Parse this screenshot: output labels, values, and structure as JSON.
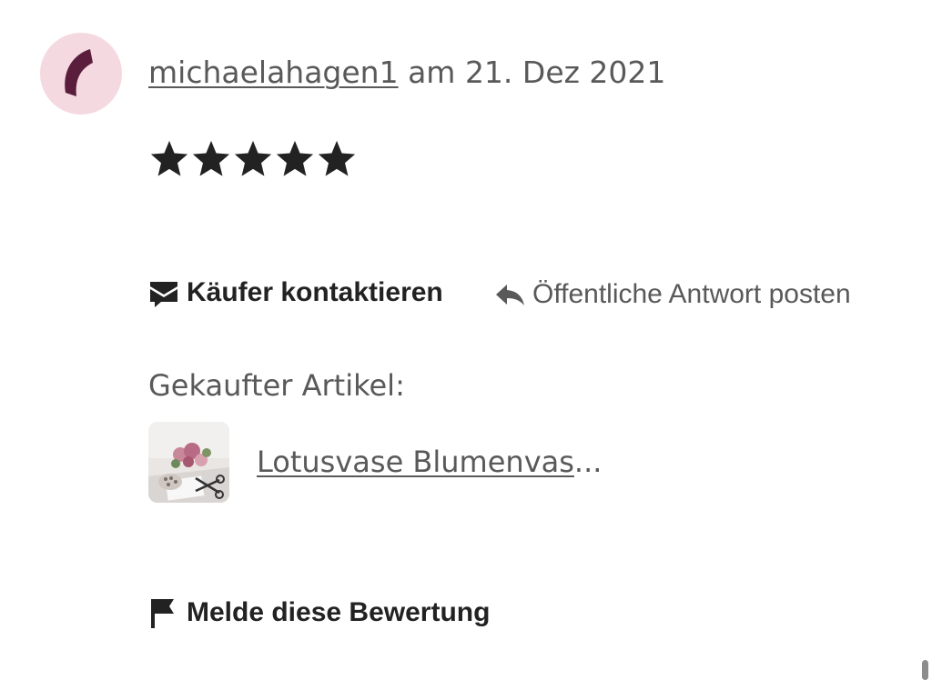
{
  "review": {
    "reviewer": {
      "username": "michaelahagen1",
      "avatar_icon": "crescent-avatar-icon",
      "avatar_bg": "#f5d9e1",
      "avatar_fg": "#5a1e3c"
    },
    "date_text": " am 21. Dez 2021",
    "rating": 5,
    "rating_max": 5
  },
  "actions": {
    "contact_label": "Käufer kontaktieren",
    "contact_icon": "envelope-icon",
    "reply_label": "Öffentliche Antwort posten",
    "reply_icon": "reply-arrow-icon"
  },
  "purchased": {
    "label": "Gekaufter Artikel:",
    "item_title": "Lotusvase Blumenvas",
    "item_ellipsis": "..."
  },
  "report": {
    "label": "Melde diese Bewertung",
    "icon": "flag-icon"
  }
}
